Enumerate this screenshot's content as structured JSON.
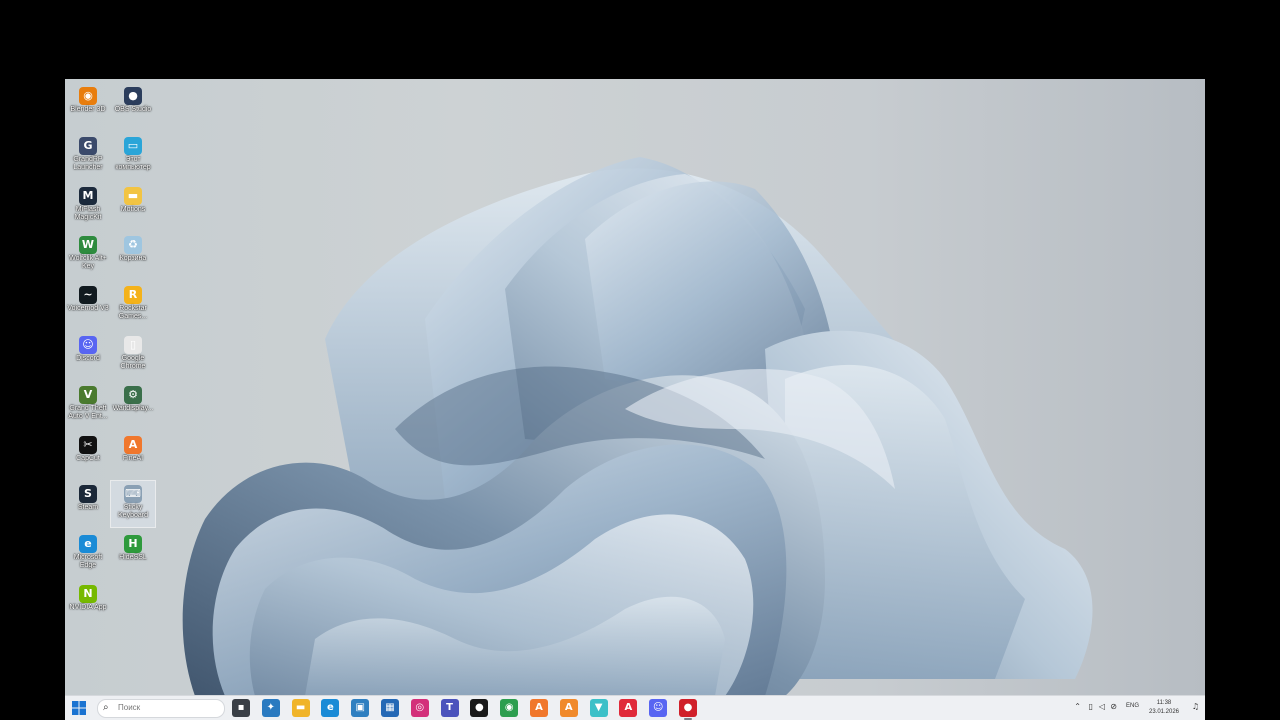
{
  "desktop": {
    "icons": [
      {
        "label": "Blender 3D",
        "glyph": "◉",
        "color": "#e87d0d"
      },
      {
        "label": "OBS Studio",
        "glyph": "●",
        "color": "#2b3d5c"
      },
      {
        "label": "GrandRP Launcher",
        "glyph": "G",
        "color": "#3b4a6b"
      },
      {
        "label": "Этот компьютер",
        "glyph": "▭",
        "color": "#2aa5d8"
      },
      {
        "label": "MiFlash MagicKit",
        "glyph": "M",
        "color": "#1c2a3c"
      },
      {
        "label": "Motions",
        "glyph": "▬",
        "color": "#f2c443"
      },
      {
        "label": "Wolfclik Alt+ Key",
        "glyph": "W",
        "color": "#2e8b3e"
      },
      {
        "label": "Корзина",
        "glyph": "♻",
        "color": "#9fc6e0"
      },
      {
        "label": "Voicemod V3",
        "glyph": "~",
        "color": "#111a1f"
      },
      {
        "label": "Rockstar Games...",
        "glyph": "R",
        "color": "#f4b21a"
      },
      {
        "label": "Discord",
        "glyph": "☺",
        "color": "#5865f2"
      },
      {
        "label": "Google Chrome",
        "glyph": "▯",
        "color": "#e8e8e8"
      },
      {
        "label": "Grand Theft Auto V Ent...",
        "glyph": "V",
        "color": "#4a7a2e"
      },
      {
        "label": "Waitdisplay...",
        "glyph": "⚙",
        "color": "#3a6f4a"
      },
      {
        "label": "CapCut",
        "glyph": "✂",
        "color": "#111111"
      },
      {
        "label": "FineAI",
        "glyph": "A",
        "color": "#f0772c"
      },
      {
        "label": "Steam",
        "glyph": "S",
        "color": "#1b2838"
      },
      {
        "label": "Sticky Keyboard",
        "glyph": "⌨",
        "color": "#8aa0b4"
      },
      {
        "label": "Microsoft Edge",
        "glyph": "e",
        "color": "#1a8bd6"
      },
      {
        "label": "HideSSL",
        "glyph": "H",
        "color": "#2e9a3c"
      },
      {
        "label": "NVIDIA App",
        "glyph": "N",
        "color": "#76b900"
      }
    ]
  },
  "taskbar": {
    "search_placeholder": "Поиск",
    "search_icon": "search-icon",
    "apps": [
      {
        "name": "task-view-icon",
        "glyph": "▪",
        "color": "#3a3f46"
      },
      {
        "name": "copilot-icon",
        "glyph": "✦",
        "color": "#2a7ac0"
      },
      {
        "name": "file-explorer-icon",
        "glyph": "▬",
        "color": "#f0b429"
      },
      {
        "name": "edge-icon",
        "glyph": "e",
        "color": "#1a8bd6"
      },
      {
        "name": "app-icon",
        "glyph": "▣",
        "color": "#2f7fc0"
      },
      {
        "name": "store-icon",
        "glyph": "▦",
        "color": "#2468b5"
      },
      {
        "name": "instagram-icon",
        "glyph": "◎",
        "color": "#d3307a"
      },
      {
        "name": "teams-icon",
        "glyph": "T",
        "color": "#4b53bc"
      },
      {
        "name": "game-icon",
        "glyph": "●",
        "color": "#1a1a1a"
      },
      {
        "name": "chrome-icon",
        "glyph": "◉",
        "color": "#2d9e4f"
      },
      {
        "name": "fineai-icon",
        "glyph": "A",
        "color": "#f0772c"
      },
      {
        "name": "fineai2-icon",
        "glyph": "A",
        "color": "#f08a2c"
      },
      {
        "name": "vpn-icon",
        "glyph": "▼",
        "color": "#3cc0c8"
      },
      {
        "name": "adobe-icon",
        "glyph": "A",
        "color": "#e02a3a"
      },
      {
        "name": "discord-icon",
        "glyph": "☺",
        "color": "#5865f2"
      },
      {
        "name": "recorder-icon",
        "glyph": "●",
        "color": "#d0202a",
        "active": true
      }
    ],
    "tray": {
      "language": "ENG",
      "time": "11:38",
      "date": "23.01.2026"
    }
  }
}
